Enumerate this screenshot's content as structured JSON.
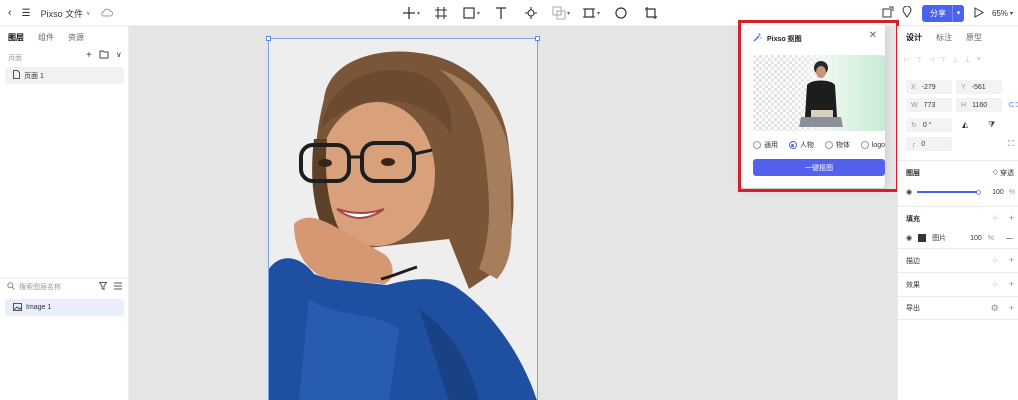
{
  "topbar": {
    "file_title": "Pixso 文件",
    "title_caret": "∨",
    "share_label": "分享",
    "zoom_label": "65%"
  },
  "left_panel": {
    "tabs": [
      "图层",
      "组件",
      "资源"
    ],
    "pages_label": "页面",
    "page_item": "页面 1",
    "search_placeholder": "搜索图层名称",
    "layer_item": "Image 1"
  },
  "popup": {
    "title": "Pixso 抠图",
    "options": [
      "通用",
      "人物",
      "物体",
      "logo"
    ],
    "selected_option": "人物",
    "button_label": "一键抠图"
  },
  "right_panel": {
    "tabs": [
      "设计",
      "标注",
      "原型"
    ],
    "x_label": "X",
    "x_value": "-279",
    "y_label": "Y",
    "y_value": "-561",
    "w_label": "W",
    "w_value": "773",
    "h_label": "H",
    "h_value": "1160",
    "rotation_value": "0 °",
    "radius_value": "0",
    "layer_section": "图层",
    "blend_mode": "穿透",
    "opacity_value": "100",
    "percent": "%",
    "fill_section": "填充",
    "fill_type": "图片",
    "fill_opacity": "100",
    "stroke_section": "描边",
    "effect_section": "效果",
    "export_section": "导出"
  },
  "colors": {
    "accent": "#4a62f0",
    "highlight_box": "#d3202a",
    "selection": "#7ea2e8"
  }
}
